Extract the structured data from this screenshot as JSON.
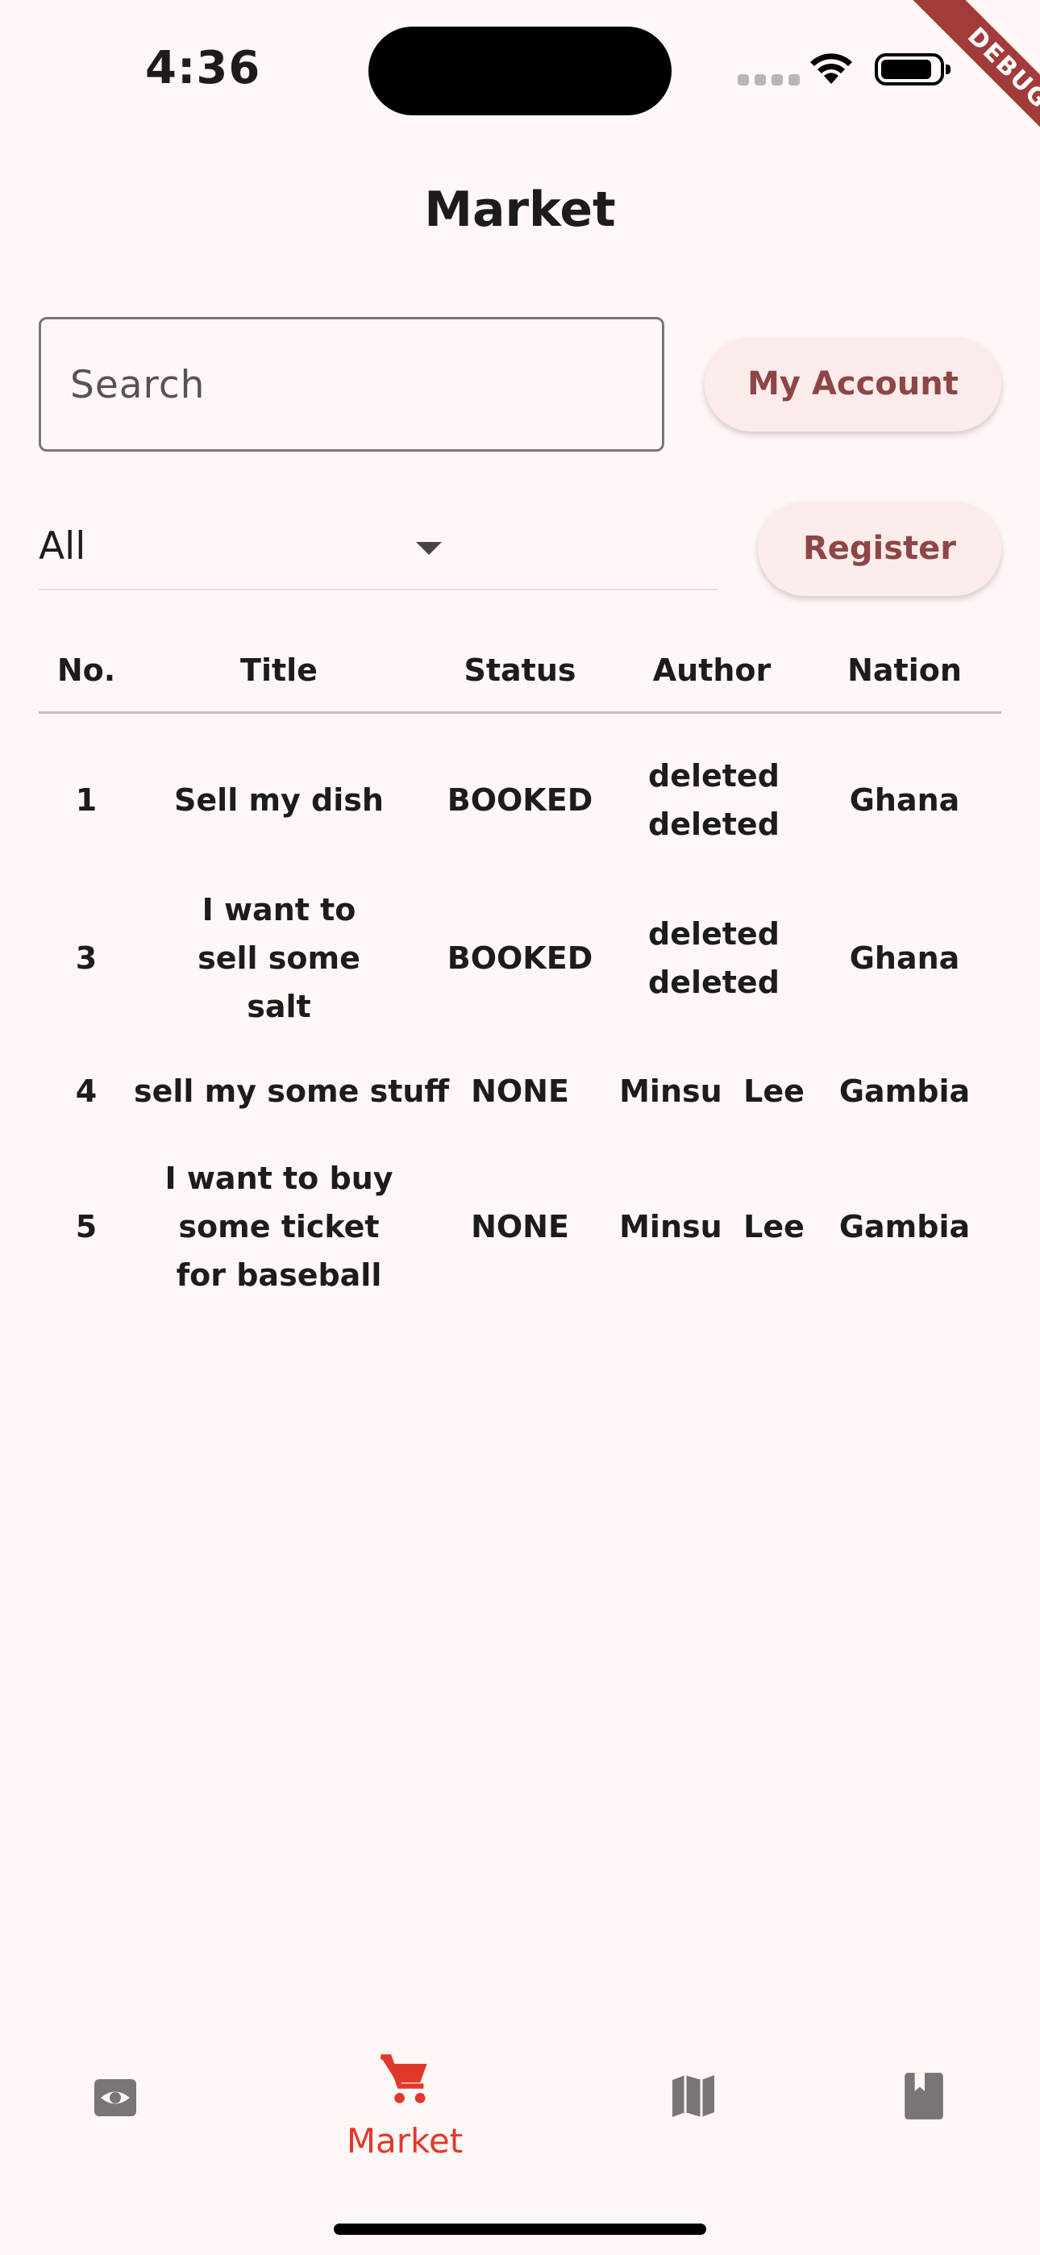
{
  "status_bar": {
    "time": "4:36",
    "debug_label": "DEBUG"
  },
  "header": {
    "title": "Market"
  },
  "search": {
    "placeholder": "Search",
    "value": ""
  },
  "buttons": {
    "account": "My Account",
    "register": "Register"
  },
  "filter": {
    "selected": "All"
  },
  "table": {
    "columns": [
      "No.",
      "Title",
      "Status",
      "Author",
      "Nation"
    ],
    "rows": [
      {
        "no": "1",
        "title": "Sell my dish",
        "status": "BOOKED",
        "author": "deleted deleted",
        "nation": "Ghana"
      },
      {
        "no": "3",
        "title": "I want to sell some salt",
        "status": "BOOKED",
        "author": "deleted deleted",
        "nation": "Ghana"
      },
      {
        "no": "4",
        "title": "sell my some stuff",
        "status": "NONE",
        "author": "Minsu  Lee",
        "nation": "Gambia"
      },
      {
        "no": "5",
        "title": "I want to buy some ticket for baseball",
        "status": "NONE",
        "author": "Minsu  Lee",
        "nation": "Gambia"
      }
    ]
  },
  "bottom_nav": {
    "items": [
      {
        "icon": "eye-icon",
        "label": ""
      },
      {
        "icon": "cart-icon",
        "label": "Market",
        "active": true
      },
      {
        "icon": "map-icon",
        "label": ""
      },
      {
        "icon": "book-icon",
        "label": ""
      }
    ]
  },
  "colors": {
    "background": "#fff7f5",
    "accent": "#e0392b",
    "button_text": "#8e4545",
    "button_bg": "#fbeceb",
    "inactive_icon": "#7a7473",
    "debug_ribbon": "#a43b3b"
  }
}
